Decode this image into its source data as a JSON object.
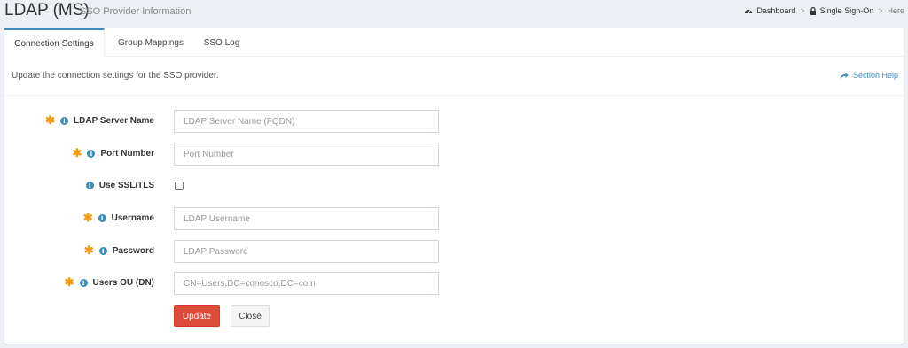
{
  "header": {
    "title": "LDAP (MS)",
    "subtitle": "SSO Provider Information"
  },
  "breadcrumb": {
    "items": [
      "Dashboard",
      "Single Sign-On",
      "Here"
    ],
    "separator": ">"
  },
  "tabs": [
    {
      "label": "Connection Settings",
      "active": true
    },
    {
      "label": "Group Mappings",
      "active": false
    },
    {
      "label": "SSO Log",
      "active": false
    }
  ],
  "intro": {
    "text": "Update the connection settings for the SSO provider.",
    "section_help": "Section Help"
  },
  "form": {
    "required_marker": "✱",
    "info_marker": "i",
    "fields": [
      {
        "label": "LDAP Server Name",
        "required": true,
        "placeholder": "LDAP Server Name (FQDN)",
        "value": ""
      },
      {
        "label": "Port Number",
        "required": true,
        "placeholder": "Port Number",
        "value": ""
      },
      {
        "label": "Use SSL/TLS",
        "required": false,
        "type": "checkbox",
        "checked": false
      },
      {
        "label": "Username",
        "required": true,
        "placeholder": "LDAP Username",
        "value": ""
      },
      {
        "label": "Password",
        "required": true,
        "placeholder": "LDAP Password",
        "value": ""
      },
      {
        "label": "Users OU (DN)",
        "required": true,
        "placeholder": "CN=Users,DC=conosco,DC=com",
        "value": ""
      }
    ],
    "buttons": {
      "update": "Update",
      "close": "Close"
    }
  },
  "colors": {
    "accent": "#3c8dbc",
    "required": "#f39c12",
    "danger": "#dd4b39"
  }
}
